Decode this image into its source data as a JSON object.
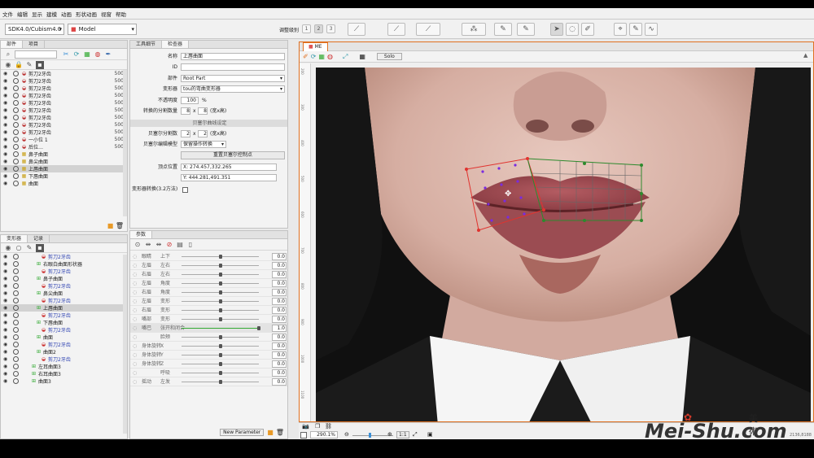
{
  "menu": [
    "文件",
    "编辑",
    "显示",
    "建模",
    "动画",
    "形状动画",
    "视窗",
    "帮助"
  ],
  "toolbar": {
    "sdk_select": "SDK4.0/Cubism4.0",
    "mode_select": "Model",
    "weight_label": "调整级别",
    "weight_1": "1",
    "weight_2": "2",
    "weight_3": "3"
  },
  "parts_panel": {
    "tabs": [
      "部件",
      "项目"
    ],
    "rows": [
      {
        "label": "剪刀2牙齿",
        "num": "500"
      },
      {
        "label": "剪刀2牙齿",
        "num": "500"
      },
      {
        "label": "剪刀2牙齿",
        "num": "500"
      },
      {
        "label": "剪刀2牙齿",
        "num": "500"
      },
      {
        "label": "剪刀2牙齿",
        "num": "500"
      },
      {
        "label": "剪刀2牙齿",
        "num": "500"
      },
      {
        "label": "剪刀2牙齿",
        "num": "500"
      },
      {
        "label": "剪刀2牙齿",
        "num": "500"
      },
      {
        "label": "剪刀2牙齿",
        "num": "500"
      },
      {
        "label": "一小位 1",
        "num": "500"
      },
      {
        "label": "后位…",
        "num": "500"
      },
      {
        "label": "鼻子曲面",
        "num": ""
      },
      {
        "label": "鼻尖曲面",
        "num": ""
      },
      {
        "label": "上唇曲面",
        "num": ""
      },
      {
        "label": "下唇曲面",
        "num": ""
      },
      {
        "label": "曲面",
        "num": ""
      }
    ]
  },
  "deformer_panel": {
    "tabs": [
      "变形器",
      "记录"
    ],
    "rows": [
      {
        "label": "剪刀2牙齿",
        "indent": 3
      },
      {
        "label": "右眼白曲面形状器",
        "indent": 2
      },
      {
        "label": "剪刀2牙齿",
        "indent": 3
      },
      {
        "label": "鼻子曲面",
        "indent": 2
      },
      {
        "label": "剪刀2牙齿",
        "indent": 3
      },
      {
        "label": "鼻尖曲面",
        "indent": 2
      },
      {
        "label": "剪刀2牙齿",
        "indent": 3
      },
      {
        "label": "上唇曲面",
        "indent": 2
      },
      {
        "label": "剪刀2牙齿",
        "indent": 3
      },
      {
        "label": "下唇曲面",
        "indent": 2
      },
      {
        "label": "剪刀2牙齿",
        "indent": 3
      },
      {
        "label": "曲面",
        "indent": 2
      },
      {
        "label": "剪刀2牙齿",
        "indent": 3
      },
      {
        "label": "曲面2",
        "indent": 2
      },
      {
        "label": "剪刀2牙齿",
        "indent": 3
      },
      {
        "label": "左耳曲面3",
        "indent": 1
      },
      {
        "label": "右耳曲面3",
        "indent": 1
      },
      {
        "label": "曲面3",
        "indent": 1
      }
    ]
  },
  "inspector": {
    "tabs": [
      "工具细节",
      "检查器"
    ],
    "name_label": "名称",
    "name": "上唇曲面",
    "id_label": "ID",
    "id": "",
    "part_label": "部件",
    "part": "Root Part",
    "deformer_label": "变形器",
    "deformer": "tou的弯曲变形器",
    "opacity_label": "不透明度",
    "opacity": "100",
    "opacity_unit": "%",
    "div_label": "转换的分割数量",
    "div_x": "8",
    "div_y": "8",
    "div_unit": "(宽x高)",
    "bezier_section": "贝塞尔曲线设定",
    "bezier_div_label": "贝塞尔分割数",
    "bezier_x": "2",
    "bezier_y": "2",
    "bezier_unit": "(宽x高)",
    "bezier_mode_label": "贝塞尔编辑模型",
    "bezier_mode": "保留操作转换",
    "reset_button": "重置贝塞尔控制点",
    "vertex_label": "顶点位置",
    "vertex_x": "274.457,332.265",
    "vertex_y": "444.281,491.351",
    "deform_label": "变形器转换(3.2方法)"
  },
  "params": {
    "tab": "参数",
    "new_button": "New Parameter",
    "rows": [
      {
        "group": "眼睛",
        "name": "上下",
        "value": "0.0",
        "knob": 0.5
      },
      {
        "group": "左眉",
        "name": "左右",
        "value": "0.0",
        "knob": 0.5
      },
      {
        "group": "右眉",
        "name": "左右",
        "value": "0.0",
        "knob": 0.5
      },
      {
        "group": "左眉",
        "name": "角度",
        "value": "0.0",
        "knob": 0.5
      },
      {
        "group": "右眉",
        "name": "角度",
        "value": "0.0",
        "knob": 0.5
      },
      {
        "group": "左眉",
        "name": "变形",
        "value": "0.0",
        "knob": 0.5
      },
      {
        "group": "右眉",
        "name": "变形",
        "value": "0.0",
        "knob": 0.5
      },
      {
        "group": "嘴部",
        "name": "变形",
        "value": "0.0",
        "knob": 0.5
      },
      {
        "group": "嘴巴",
        "name": "张开和闭合",
        "value": "1.0",
        "knob": 1.0,
        "active": true
      },
      {
        "group": "",
        "name": "脸颊",
        "value": "0.0",
        "knob": 0.5
      },
      {
        "group": "身体旋转",
        "name": "X",
        "value": "0.0",
        "knob": 0.5
      },
      {
        "group": "身体旋转",
        "name": "Y",
        "value": "0.0",
        "knob": 0.5
      },
      {
        "group": "身体旋转",
        "name": "Z",
        "value": "0.0",
        "knob": 0.5
      },
      {
        "group": "",
        "name": "呼吸",
        "value": "0.0",
        "knob": 0.5
      },
      {
        "group": "摇动",
        "name": "左发",
        "value": "0.0",
        "knob": 0.5
      }
    ]
  },
  "viewer": {
    "tab": "ME",
    "solo": "Solo",
    "ruler": [
      "200",
      "300",
      "400",
      "500",
      "600",
      "700",
      "800",
      "900",
      "1000",
      "1100"
    ]
  },
  "status": {
    "zoom": "290.1",
    "zoom_unit": "%",
    "ratio": "1:1",
    "coords": "2136,8188"
  },
  "watermark": {
    "text": "Mei-Shu.com",
    "cn": "美術網"
  }
}
